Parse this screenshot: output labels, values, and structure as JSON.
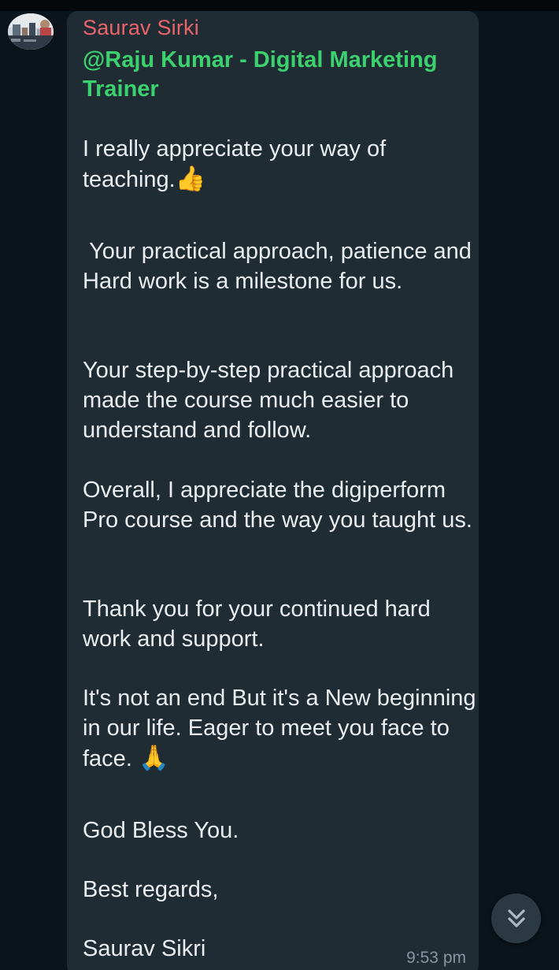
{
  "message": {
    "sender": "Saurav Sirki",
    "mention": "@Raju Kumar - Digital Marketing Trainer",
    "paragraphs": [
      "I really appreciate your way of teaching.",
      " Your practical approach, patience and Hard work is a milestone for us.",
      "Your step-by-step practical approach made the course much easier to understand and follow.",
      "Overall, I appreciate the digiperform Pro course and the way you taught us.",
      "Thank you for your continued hard work and support.",
      "It's not an end But it's a New beginning in our life. Eager to meet you face to face.",
      "God Bless You.",
      "Best regards,",
      "Saurav Sikri"
    ],
    "emojis": {
      "thumbs_up": "👍",
      "folded_hands": "🙏"
    },
    "time": "9:53 pm"
  },
  "colors": {
    "background": "#0b141a",
    "bubble": "#202c33",
    "sender": "#e9646b",
    "mention": "#3bd16f",
    "text": "#e9edef",
    "time": "#8696a0"
  },
  "icons": {
    "avatar": "group-avatar",
    "scroll": "double-chevron-down-icon"
  }
}
